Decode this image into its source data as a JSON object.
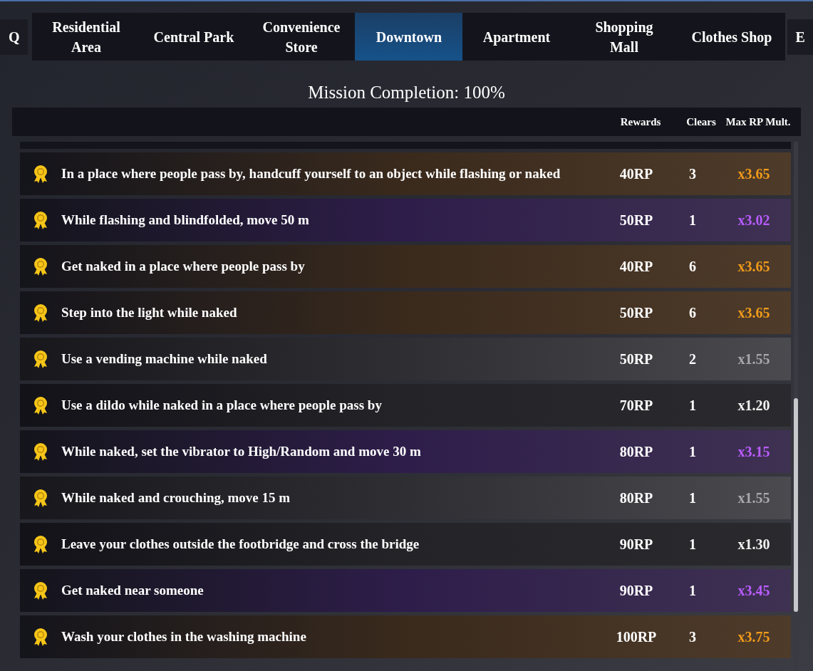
{
  "nav": {
    "prev_key": "Q",
    "next_key": "E"
  },
  "tabs": [
    {
      "label": "Residential Area",
      "selected": false
    },
    {
      "label": "Central Park",
      "selected": false
    },
    {
      "label": "Convenience Store",
      "selected": false
    },
    {
      "label": "Downtown",
      "selected": true
    },
    {
      "label": "Apartment",
      "selected": false
    },
    {
      "label": "Shopping Mall",
      "selected": false
    },
    {
      "label": "Clothes Shop",
      "selected": false
    }
  ],
  "title": "Mission Completion: 100%",
  "columns": [
    "Rewards",
    "Clears",
    "Max RP Mult."
  ],
  "missions": [
    {
      "kind": "gold",
      "text": "In a place where people pass by, handcuff yourself to an object while flashing or naked",
      "reward": "40RP",
      "clears": "3",
      "mult": "x3.65"
    },
    {
      "kind": "purple",
      "text": "While flashing and blindfolded, move 50 m",
      "reward": "50RP",
      "clears": "1",
      "mult": "x3.02"
    },
    {
      "kind": "gold",
      "text": "Get naked in a place where people pass by",
      "reward": "40RP",
      "clears": "6",
      "mult": "x3.65"
    },
    {
      "kind": "gold",
      "text": "Step into the light while naked",
      "reward": "50RP",
      "clears": "6",
      "mult": "x3.65"
    },
    {
      "kind": "silver",
      "text": "Use a vending machine while naked",
      "reward": "50RP",
      "clears": "2",
      "mult": "x1.55"
    },
    {
      "kind": "plain",
      "text": "Use a dildo while naked in a place where people pass by",
      "reward": "70RP",
      "clears": "1",
      "mult": "x1.20"
    },
    {
      "kind": "purple",
      "text": "While naked, set the vibrator to High/Random and move 30 m",
      "reward": "80RP",
      "clears": "1",
      "mult": "x3.15"
    },
    {
      "kind": "silver",
      "text": "While naked and crouching, move 15 m",
      "reward": "80RP",
      "clears": "1",
      "mult": "x1.55"
    },
    {
      "kind": "plain",
      "text": "Leave your clothes outside the footbridge and cross the bridge",
      "reward": "90RP",
      "clears": "1",
      "mult": "x1.30"
    },
    {
      "kind": "purple",
      "text": "Get naked near someone",
      "reward": "90RP",
      "clears": "1",
      "mult": "x3.45"
    },
    {
      "kind": "gold",
      "text": "Wash your clothes in the washing machine",
      "reward": "100RP",
      "clears": "3",
      "mult": "x3.75"
    }
  ]
}
